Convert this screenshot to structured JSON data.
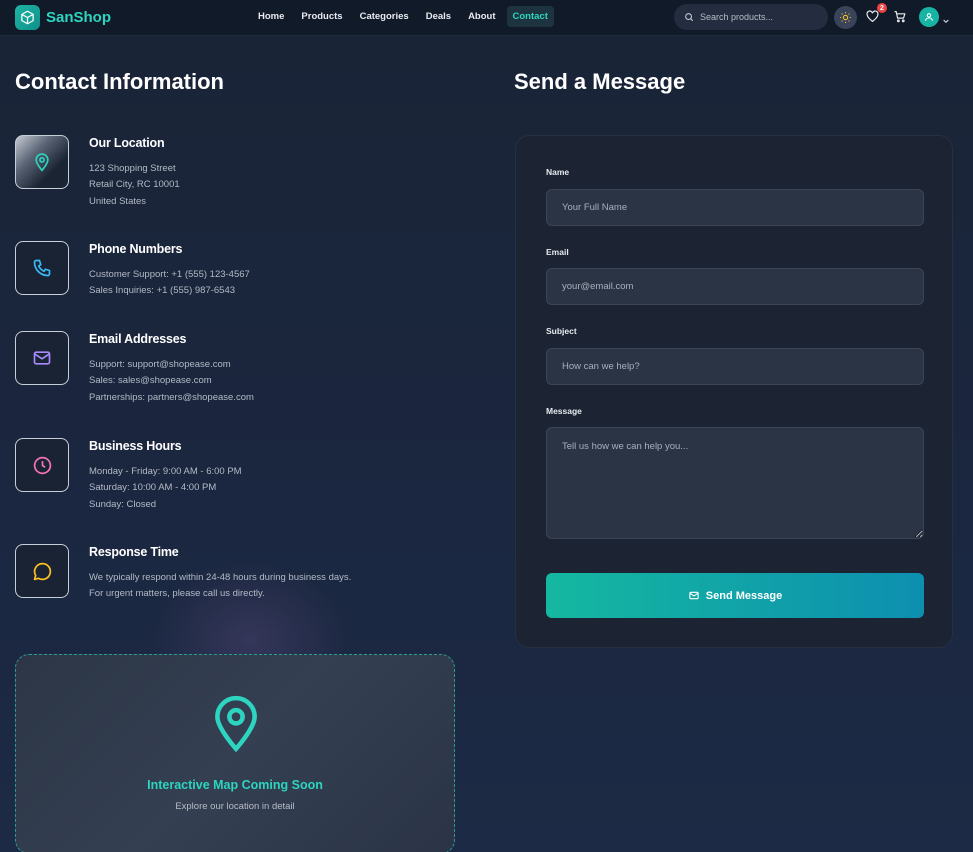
{
  "nav": {
    "brand": "SanShop",
    "links": [
      "Home",
      "Products",
      "Categories",
      "Deals",
      "About",
      "Contact"
    ],
    "active": "Contact",
    "search_placeholder": "Search products...",
    "wishlist_count": "2"
  },
  "contact": {
    "title": "Contact Information",
    "items": [
      {
        "title": "Our Location",
        "lines": [
          "123 Shopping Street",
          "Retail City, RC 10001",
          "United States"
        ],
        "icon": "map-pin-icon",
        "color": "#2dd4bf"
      },
      {
        "title": "Phone Numbers",
        "lines": [
          "Customer Support: +1 (555) 123-4567",
          "Sales Inquiries: +1 (555) 987-6543"
        ],
        "icon": "phone-icon",
        "color": "#38bdf8"
      },
      {
        "title": "Email Addresses",
        "lines": [
          "Support: support@shopease.com",
          "Sales: sales@shopease.com",
          "Partnerships: partners@shopease.com"
        ],
        "icon": "mail-icon",
        "color": "#a78bfa"
      },
      {
        "title": "Business Hours",
        "lines": [
          "Monday - Friday: 9:00 AM - 6:00 PM",
          "Saturday: 10:00 AM - 4:00 PM",
          "Sunday: Closed"
        ],
        "icon": "clock-icon",
        "color": "#f472b6"
      },
      {
        "title": "Response Time",
        "lines": [
          "We typically respond within 24-48 hours during business days.",
          "For urgent matters, please call us directly."
        ],
        "icon": "chat-bubble-icon",
        "color": "#fbbf24"
      }
    ]
  },
  "map": {
    "title": "Interactive Map Coming Soon",
    "subtitle": "Explore our location in detail"
  },
  "form": {
    "title": "Send a Message",
    "name_label": "Name",
    "name_placeholder": "Your Full Name",
    "email_label": "Email",
    "email_placeholder": "your@email.com",
    "subject_label": "Subject",
    "subject_placeholder": "How can we help?",
    "message_label": "Message",
    "message_placeholder": "Tell us how we can help you...",
    "submit_label": "Send Message"
  },
  "colors": {
    "accent": "#2dd4bf",
    "background": "#1b2740",
    "card": "#1c2433"
  }
}
